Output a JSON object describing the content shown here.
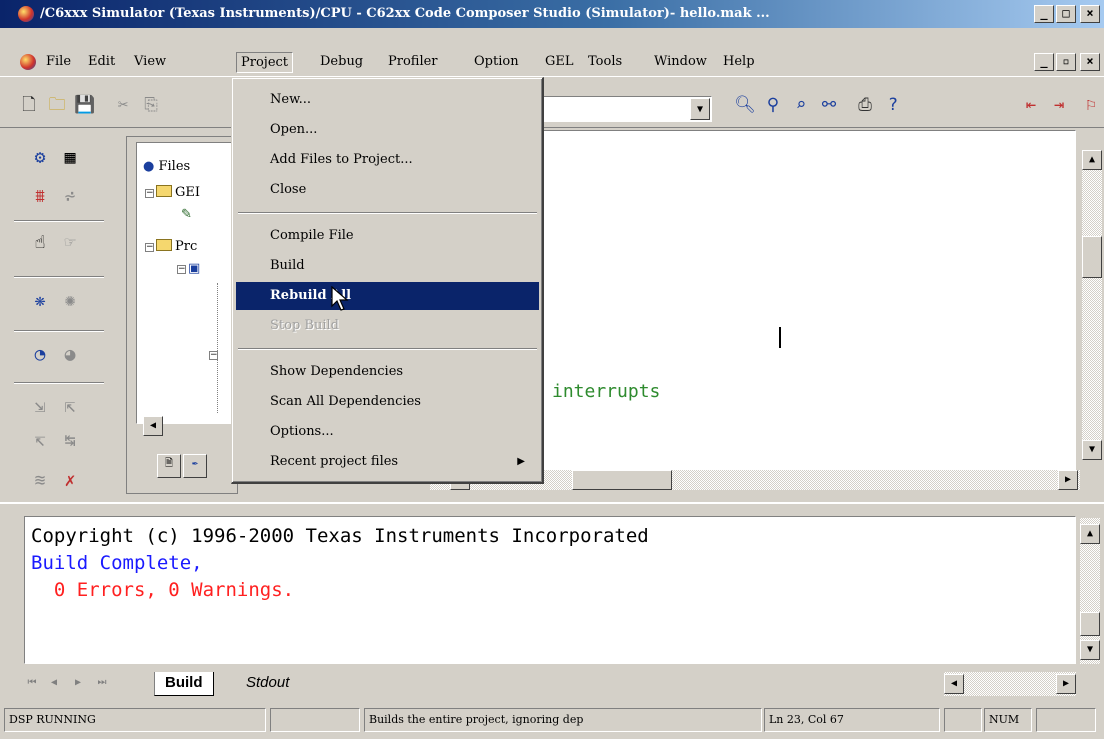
{
  "window": {
    "title": "/C6xxx Simulator (Texas Instruments)/CPU - C62xx Code Composer Studio (Simulator)- hello.mak ...",
    "controls": [
      "_",
      "□",
      "×"
    ]
  },
  "menubar": {
    "items": [
      "File",
      "Edit",
      "View",
      "Project",
      "Debug",
      "Profiler",
      "Option",
      "GEL",
      "Tools",
      "Window",
      "Help"
    ],
    "doc_controls": [
      "_",
      "▫",
      "×"
    ]
  },
  "project_menu": {
    "items": [
      {
        "label": "New...",
        "state": "normal"
      },
      {
        "label": "Open...",
        "state": "normal"
      },
      {
        "label": "Add Files to Project...",
        "state": "normal"
      },
      {
        "label": "Close",
        "state": "normal"
      },
      {
        "label": "Compile File",
        "state": "normal"
      },
      {
        "label": "Build",
        "state": "normal"
      },
      {
        "label": "Rebuild All",
        "state": "highlighted"
      },
      {
        "label": "Stop Build",
        "state": "disabled"
      },
      {
        "label": "Show Dependencies",
        "state": "normal"
      },
      {
        "label": "Scan All Dependencies",
        "state": "normal"
      },
      {
        "label": "Options...",
        "state": "normal"
      },
      {
        "label": "Recent project files",
        "state": "submenu"
      }
    ],
    "submenu_arrow": "▶"
  },
  "project_tree": {
    "root": "Files",
    "nodes": [
      "GEI",
      "Prc"
    ]
  },
  "editor": {
    "visible_text": "interrupts",
    "text_color": "#2e8b2e"
  },
  "output": {
    "lines": [
      {
        "text": "Copyright (c) 1996-2000 Texas Instruments Incorporated",
        "color": "#000000"
      },
      {
        "text": "Build Complete,",
        "color": "#1a1aff"
      },
      {
        "text": "  0 Errors, 0 Warnings.",
        "color": "#ff2020"
      }
    ],
    "tabs": [
      "Build",
      "Stdout"
    ]
  },
  "statusbar": {
    "state": "DSP RUNNING",
    "message": "Builds the entire project, ignoring dep",
    "position": "Ln 23, Col 67",
    "num": "NUM"
  },
  "colors": {
    "titlebar_start": "#0a246a",
    "menu_highlight": "#0a246a",
    "face": "#d4d0c8"
  }
}
